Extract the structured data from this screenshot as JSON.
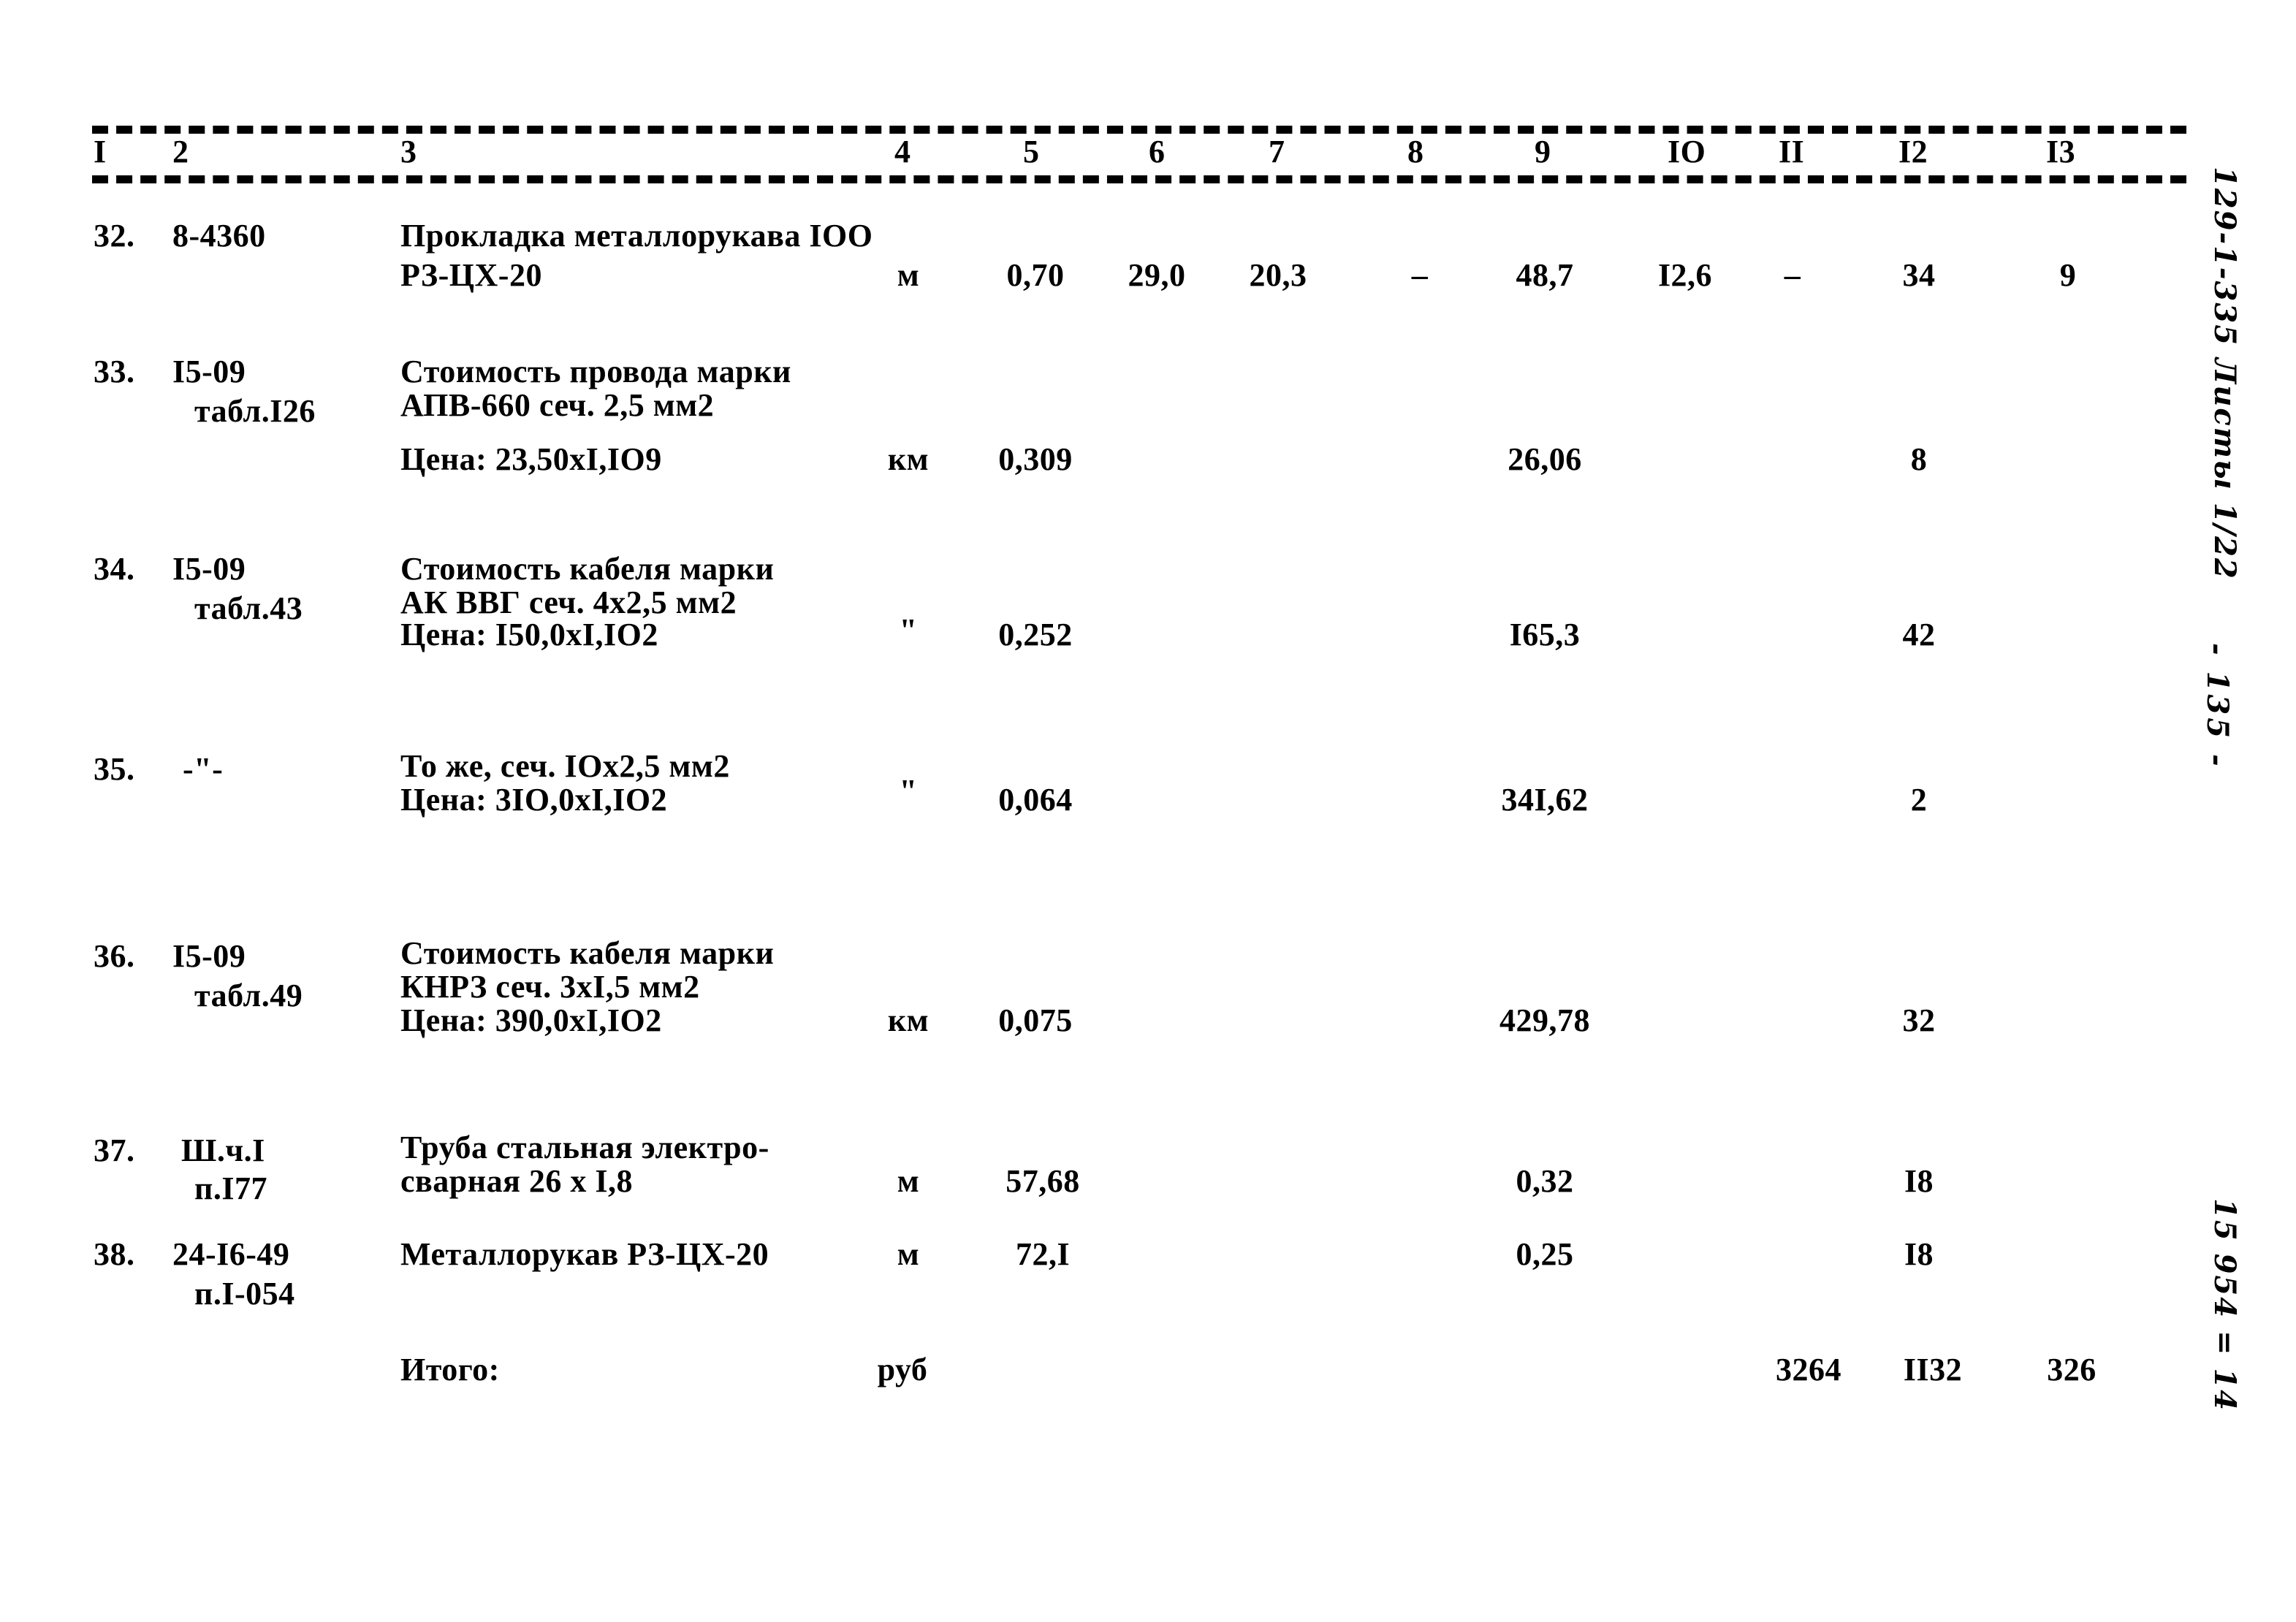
{
  "document": {
    "kind": "estimate-sheet",
    "currency_unit": "руб"
  },
  "table": {
    "column_headers": [
      "I",
      "2",
      "3",
      "4",
      "5",
      "6",
      "7",
      "8",
      "9",
      "IO",
      "II",
      "I2",
      "I3"
    ],
    "rows": [
      {
        "no": "32.",
        "code_lines": [
          "8-4360"
        ],
        "desc_lines": [
          "Прокладка металлорукава IOO",
          "РЗ-ЦХ-20"
        ],
        "unit": "м",
        "c5": "0,70",
        "c6": "29,0",
        "c7": "20,3",
        "c8": "–",
        "c9": "48,7",
        "c10": "I2,6",
        "c11": "–",
        "c12": "34",
        "c13": "9"
      },
      {
        "no": "33.",
        "code_lines": [
          "I5-09",
          "табл.I26"
        ],
        "desc_lines": [
          "Стоимость провода марки",
          "АПВ-660 сеч. 2,5 мм2",
          "",
          "Цена: 23,50хI,IO9"
        ],
        "unit": "км",
        "c5": "0,309",
        "c6": "",
        "c7": "",
        "c8": "",
        "c9": "26,06",
        "c10": "",
        "c11": "",
        "c12": "8",
        "c13": ""
      },
      {
        "no": "34.",
        "code_lines": [
          "I5-09",
          "табл.43"
        ],
        "desc_lines": [
          "Стоимость кабеля марки",
          "АК ВВГ сеч. 4х2,5 мм2",
          "Цена: I50,0хI,IO2"
        ],
        "unit": "\"",
        "c5": "0,252",
        "c6": "",
        "c7": "",
        "c8": "",
        "c9": "I65,3",
        "c10": "",
        "c11": "",
        "c12": "42",
        "c13": ""
      },
      {
        "no": "35.",
        "code_lines": [
          "-\"-"
        ],
        "desc_lines": [
          "То же, сеч. IOх2,5 мм2",
          "Цена: 3IO,0хI,IO2"
        ],
        "unit": "\"",
        "c5": "0,064",
        "c6": "",
        "c7": "",
        "c8": "",
        "c9": "34I,62",
        "c10": "",
        "c11": "",
        "c12": "2",
        "c13": ""
      },
      {
        "no": "36.",
        "code_lines": [
          "I5-09",
          "табл.49"
        ],
        "desc_lines": [
          "Стоимость кабеля марки",
          "КНРЗ сеч. 3хI,5 мм2",
          "Цена: 390,0хI,IO2"
        ],
        "unit": "км",
        "c5": "0,075",
        "c6": "",
        "c7": "",
        "c8": "",
        "c9": "429,78",
        "c10": "",
        "c11": "",
        "c12": "32",
        "c13": ""
      },
      {
        "no": "37.",
        "code_lines": [
          "Ш.ч.I",
          "п.I77"
        ],
        "desc_lines": [
          "Труба стальная электро-",
          "сварная 26 х I,8"
        ],
        "unit": "м",
        "c5": "57,68",
        "c6": "",
        "c7": "",
        "c8": "",
        "c9": "0,32",
        "c10": "",
        "c11": "",
        "c12": "I8",
        "c13": ""
      },
      {
        "no": "38.",
        "code_lines": [
          "24-I6-49",
          "п.I-054"
        ],
        "desc_lines": [
          "Металлорукав РЗ-ЦХ-20"
        ],
        "unit": "м",
        "c5": "72,I",
        "c6": "",
        "c7": "",
        "c8": "",
        "c9": "0,25",
        "c10": "",
        "c11": "",
        "c12": "I8",
        "c13": ""
      }
    ],
    "total_row": {
      "label": "Итого:",
      "unit": "руб",
      "c11": "3264",
      "c12": "II32",
      "c13": "326"
    }
  },
  "marginalia": {
    "code_note": "129-1-335 Листы 1/22",
    "page_note": "- 135 -",
    "sum_note": "15 954 = 14"
  }
}
